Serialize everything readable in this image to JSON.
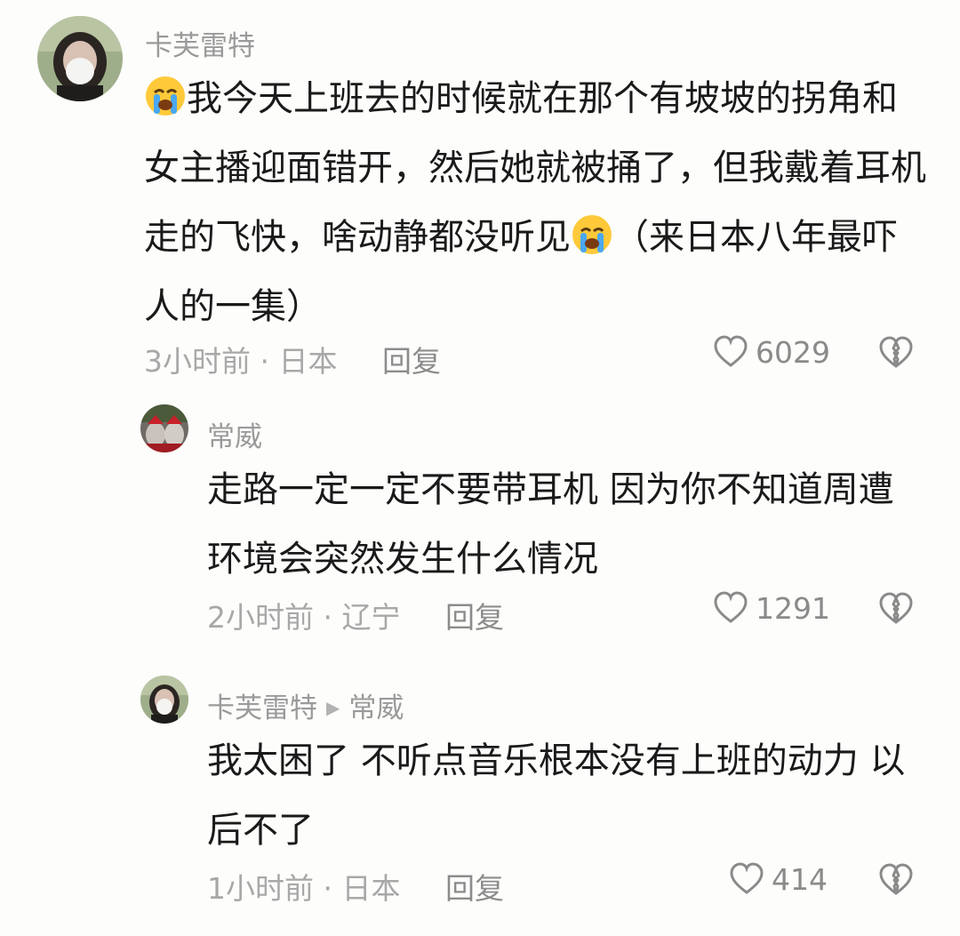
{
  "comments": [
    {
      "username": "卡芙雷特",
      "text_part1": "我今天上班去的时候就在那个有坡坡的拐角和女主播迎面错开，然后她就被捅了，但我戴着耳机走的飞快，啥动静都没听见",
      "text_part2": "（来日本八年最吓人的一集）",
      "time": "3小时前",
      "location": "日本",
      "reply_label": "回复",
      "likes": "6029"
    },
    {
      "username": "常威",
      "text": "走路一定一定不要带耳机 因为你不知道周遭环境会突然发生什么情况",
      "time": "2小时前",
      "location": "辽宁",
      "reply_label": "回复",
      "likes": "1291"
    },
    {
      "username": "卡芙雷特",
      "reply_to": "常威",
      "text": "我太困了 不听点音乐根本没有上班的动力 以后不了",
      "time": "1小时前",
      "location": "日本",
      "reply_label": "回复",
      "likes": "414"
    }
  ],
  "meta_separator": "·",
  "emoji_icon": "crying-face-emoji",
  "like_icon": "heart-outline-icon",
  "dislike_icon": "broken-heart-icon",
  "colors": {
    "background": "#fdfdfb",
    "text": "#1a1a1a",
    "muted": "#a8a8a8"
  }
}
